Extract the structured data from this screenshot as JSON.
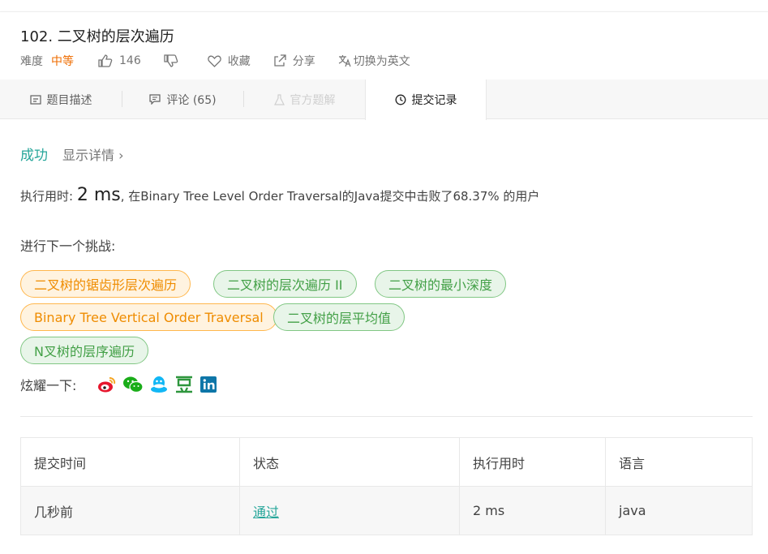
{
  "problem": {
    "title": "102. 二叉树的层次遍历",
    "difficulty_label": "难度",
    "difficulty": "中等",
    "likes": "146",
    "favorite_label": "收藏",
    "share_label": "分享",
    "translate_label": "切换为英文"
  },
  "tabs": [
    {
      "label": "题目描述",
      "icon": "description-icon"
    },
    {
      "label": "评论 (65)",
      "icon": "comment-icon"
    },
    {
      "label": "官方题解",
      "icon": "flask-icon",
      "disabled": true
    },
    {
      "label": "提交记录",
      "icon": "clock-icon",
      "active": true
    }
  ],
  "result": {
    "status": "成功",
    "details_link": "显示详情 ›",
    "runtime_prefix": "执行用时: ",
    "runtime_value": "2 ms",
    "runtime_suffix": ", 在Binary Tree Level Order Traversal的Java提交中击败了68.37% 的用户"
  },
  "next_challenge": {
    "label": "进行下一个挑战:",
    "items": [
      {
        "label": "二叉树的锯齿形层次遍历",
        "color": "orange"
      },
      {
        "label": "二叉树的层次遍历 II",
        "color": "green"
      },
      {
        "label": "二叉树的最小深度",
        "color": "green"
      },
      {
        "label": "Binary Tree Vertical Order Traversal",
        "color": "orange"
      },
      {
        "label": "二叉树的层平均值",
        "color": "green"
      },
      {
        "label": "N叉树的层序遍历",
        "color": "green"
      }
    ]
  },
  "share": {
    "label": "炫耀一下:",
    "icons": [
      "weibo-icon",
      "wechat-icon",
      "qq-icon",
      "douban-icon",
      "linkedin-icon"
    ]
  },
  "submissions": {
    "headers": [
      "提交时间",
      "状态",
      "执行用时",
      "语言"
    ],
    "rows": [
      [
        "几秒前",
        "通过",
        "2 ms",
        "java"
      ]
    ]
  },
  "colors": {
    "success": "#26a69a",
    "medium": "#ef6c00",
    "orange_pill": "#ef8c00",
    "green_pill": "#43a047"
  }
}
